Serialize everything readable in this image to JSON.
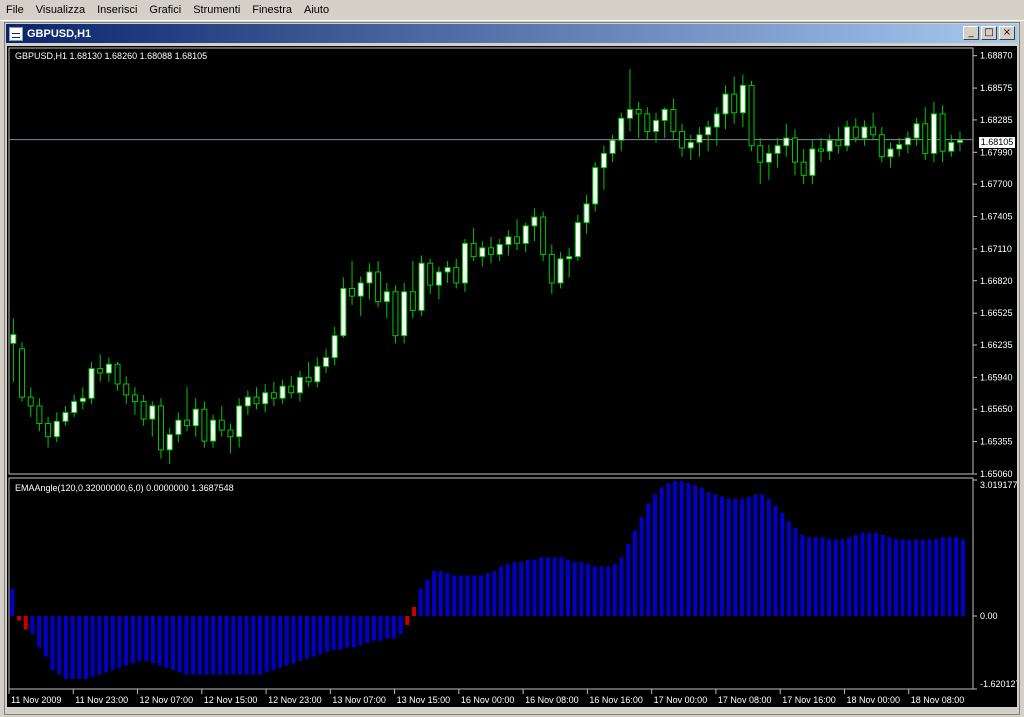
{
  "menu": [
    "File",
    "Visualizza",
    "Inserisci",
    "Grafici",
    "Strumenti",
    "Finestra",
    "Aiuto"
  ],
  "window": {
    "title": "GBPUSD,H1",
    "buttons": {
      "minimize": "_",
      "maximize": "□",
      "close": "×"
    }
  },
  "chart": {
    "symbol_label": "GBPUSD,H1  1.68130 1.68260 1.68088 1.68105",
    "current_price": "1.68105",
    "price_ticks": [
      "1.68870",
      "1.68575",
      "1.68285",
      "1.67990",
      "1.67700",
      "1.67405",
      "1.67110",
      "1.66820",
      "1.66525",
      "1.66235",
      "1.65940",
      "1.65650",
      "1.65355",
      "1.65060"
    ],
    "indicator_label": "EMAAngle(120,0.32000000,6,0) 0.0000000 1.3687548",
    "indicator_ticks": [
      "3.019177",
      "0.00",
      "-1.620127"
    ],
    "time_labels": [
      "11 Nov 2009",
      "11 Nov 23:00",
      "12 Nov 07:00",
      "12 Nov 15:00",
      "12 Nov 23:00",
      "13 Nov 07:00",
      "13 Nov 15:00",
      "16 Nov 00:00",
      "16 Nov 08:00",
      "16 Nov 16:00",
      "17 Nov 00:00",
      "17 Nov 08:00",
      "17 Nov 16:00",
      "18 Nov 00:00",
      "18 Nov 08:00"
    ],
    "colors": {
      "background": "#000000",
      "candle_bull": "#ffffff",
      "candle_bear": "#000000",
      "wick": "#00c800",
      "hist_pos": "#0000c8",
      "hist_neg": "#0000c8",
      "hist_flat": "#c80000",
      "grid_text": "#ffffff"
    }
  },
  "chart_data": {
    "type": "candlestick",
    "price_range": [
      1.6506,
      1.6894
    ],
    "candles": [
      [
        1.6625,
        1.6648,
        1.659,
        1.6633
      ],
      [
        1.662,
        1.6626,
        1.6572,
        1.6576
      ],
      [
        1.6576,
        1.6585,
        1.6558,
        1.6568
      ],
      [
        1.6568,
        1.6575,
        1.6545,
        1.6552
      ],
      [
        1.6552,
        1.6558,
        1.653,
        1.654
      ],
      [
        1.654,
        1.6562,
        1.6535,
        1.6554
      ],
      [
        1.6554,
        1.6568,
        1.655,
        1.6562
      ],
      [
        1.6562,
        1.6578,
        1.6558,
        1.6572
      ],
      [
        1.6572,
        1.6585,
        1.6565,
        1.6575
      ],
      [
        1.6575,
        1.6608,
        1.657,
        1.6602
      ],
      [
        1.6602,
        1.6615,
        1.659,
        1.6598
      ],
      [
        1.6598,
        1.6612,
        1.659,
        1.6606
      ],
      [
        1.6606,
        1.6608,
        1.6582,
        1.6588
      ],
      [
        1.6588,
        1.6595,
        1.657,
        1.6578
      ],
      [
        1.6578,
        1.6585,
        1.656,
        1.6572
      ],
      [
        1.6572,
        1.6578,
        1.655,
        1.6556
      ],
      [
        1.6556,
        1.6572,
        1.654,
        1.6568
      ],
      [
        1.6568,
        1.6575,
        1.652,
        1.6528
      ],
      [
        1.6528,
        1.6548,
        1.6515,
        1.6542
      ],
      [
        1.6542,
        1.6562,
        1.6535,
        1.6555
      ],
      [
        1.6555,
        1.6585,
        1.6545,
        1.655
      ],
      [
        1.655,
        1.6575,
        1.654,
        1.6565
      ],
      [
        1.6565,
        1.6572,
        1.653,
        1.6536
      ],
      [
        1.6536,
        1.656,
        1.653,
        1.6555
      ],
      [
        1.6555,
        1.6568,
        1.654,
        1.6546
      ],
      [
        1.6546,
        1.6552,
        1.6525,
        1.654
      ],
      [
        1.654,
        1.6575,
        1.653,
        1.6568
      ],
      [
        1.6568,
        1.6582,
        1.656,
        1.6576
      ],
      [
        1.6576,
        1.6585,
        1.6565,
        1.657
      ],
      [
        1.657,
        1.6588,
        1.6562,
        1.658
      ],
      [
        1.658,
        1.659,
        1.6568,
        1.6575
      ],
      [
        1.6575,
        1.6592,
        1.657,
        1.6586
      ],
      [
        1.6586,
        1.6595,
        1.6575,
        1.658
      ],
      [
        1.658,
        1.66,
        1.6572,
        1.6594
      ],
      [
        1.6594,
        1.6608,
        1.6585,
        1.659
      ],
      [
        1.659,
        1.6612,
        1.6585,
        1.6604
      ],
      [
        1.6604,
        1.662,
        1.6598,
        1.6612
      ],
      [
        1.6612,
        1.664,
        1.6605,
        1.6632
      ],
      [
        1.6632,
        1.6685,
        1.663,
        1.6675
      ],
      [
        1.6675,
        1.67,
        1.666,
        1.6668
      ],
      [
        1.6668,
        1.6686,
        1.665,
        1.668
      ],
      [
        1.668,
        1.6698,
        1.6665,
        1.669
      ],
      [
        1.669,
        1.67,
        1.6658,
        1.6663
      ],
      [
        1.6663,
        1.668,
        1.6648,
        1.6672
      ],
      [
        1.6672,
        1.6678,
        1.6625,
        1.6632
      ],
      [
        1.6632,
        1.668,
        1.6625,
        1.6672
      ],
      [
        1.6672,
        1.67,
        1.6648,
        1.6655
      ],
      [
        1.6655,
        1.6705,
        1.665,
        1.6698
      ],
      [
        1.6698,
        1.6702,
        1.667,
        1.6678
      ],
      [
        1.6678,
        1.6695,
        1.6665,
        1.669
      ],
      [
        1.669,
        1.67,
        1.668,
        1.6694
      ],
      [
        1.6694,
        1.6702,
        1.6675,
        1.668
      ],
      [
        1.668,
        1.672,
        1.6672,
        1.6716
      ],
      [
        1.6716,
        1.673,
        1.67,
        1.6704
      ],
      [
        1.6704,
        1.6718,
        1.6695,
        1.6712
      ],
      [
        1.6712,
        1.6722,
        1.6698,
        1.6706
      ],
      [
        1.6706,
        1.672,
        1.67,
        1.6715
      ],
      [
        1.6715,
        1.6728,
        1.6705,
        1.6722
      ],
      [
        1.6722,
        1.6738,
        1.671,
        1.6716
      ],
      [
        1.6716,
        1.6735,
        1.6708,
        1.6732
      ],
      [
        1.6732,
        1.6748,
        1.6718,
        1.674
      ],
      [
        1.674,
        1.6745,
        1.67,
        1.6706
      ],
      [
        1.6706,
        1.6715,
        1.667,
        1.668
      ],
      [
        1.668,
        1.6708,
        1.6675,
        1.6702
      ],
      [
        1.6702,
        1.6712,
        1.6685,
        1.6704
      ],
      [
        1.6704,
        1.6742,
        1.67,
        1.6735
      ],
      [
        1.6735,
        1.676,
        1.6725,
        1.6752
      ],
      [
        1.6752,
        1.679,
        1.6745,
        1.6785
      ],
      [
        1.6785,
        1.6805,
        1.6765,
        1.6798
      ],
      [
        1.6798,
        1.6815,
        1.679,
        1.681
      ],
      [
        1.681,
        1.6835,
        1.68,
        1.683
      ],
      [
        1.683,
        1.6875,
        1.6818,
        1.6838
      ],
      [
        1.6838,
        1.6845,
        1.6812,
        1.6834
      ],
      [
        1.6834,
        1.684,
        1.681,
        1.6818
      ],
      [
        1.6818,
        1.6835,
        1.6808,
        1.6828
      ],
      [
        1.6828,
        1.684,
        1.6812,
        1.6838
      ],
      [
        1.6838,
        1.6848,
        1.681,
        1.6818
      ],
      [
        1.6818,
        1.6825,
        1.6795,
        1.6803
      ],
      [
        1.6803,
        1.6815,
        1.6792,
        1.6808
      ],
      [
        1.6808,
        1.6822,
        1.6795,
        1.6815
      ],
      [
        1.6815,
        1.6828,
        1.68,
        1.6822
      ],
      [
        1.6822,
        1.684,
        1.6805,
        1.6834
      ],
      [
        1.6834,
        1.686,
        1.682,
        1.6852
      ],
      [
        1.6852,
        1.6868,
        1.6825,
        1.6835
      ],
      [
        1.6835,
        1.687,
        1.6822,
        1.686
      ],
      [
        1.686,
        1.6864,
        1.68,
        1.6805
      ],
      [
        1.6805,
        1.6812,
        1.677,
        1.679
      ],
      [
        1.679,
        1.6806,
        1.6774,
        1.6798
      ],
      [
        1.6798,
        1.6812,
        1.6785,
        1.6805
      ],
      [
        1.6805,
        1.6825,
        1.6795,
        1.6812
      ],
      [
        1.6812,
        1.682,
        1.6778,
        1.679
      ],
      [
        1.679,
        1.6802,
        1.677,
        1.6778
      ],
      [
        1.6778,
        1.681,
        1.677,
        1.6802
      ],
      [
        1.6802,
        1.6812,
        1.679,
        1.68
      ],
      [
        1.68,
        1.6815,
        1.6792,
        1.681
      ],
      [
        1.681,
        1.6822,
        1.6798,
        1.6805
      ],
      [
        1.6805,
        1.6828,
        1.68,
        1.6822
      ],
      [
        1.6822,
        1.683,
        1.6808,
        1.6812
      ],
      [
        1.6812,
        1.6828,
        1.6805,
        1.6822
      ],
      [
        1.6822,
        1.6835,
        1.681,
        1.6815
      ],
      [
        1.6815,
        1.6822,
        1.679,
        1.6795
      ],
      [
        1.6795,
        1.6808,
        1.6785,
        1.6802
      ],
      [
        1.6802,
        1.6812,
        1.6795,
        1.6806
      ],
      [
        1.6806,
        1.6818,
        1.6798,
        1.6812
      ],
      [
        1.6812,
        1.683,
        1.6805,
        1.6825
      ],
      [
        1.6825,
        1.684,
        1.6792,
        1.6798
      ],
      [
        1.6798,
        1.6845,
        1.679,
        1.6834
      ],
      [
        1.6834,
        1.6842,
        1.679,
        1.68
      ],
      [
        1.68,
        1.6815,
        1.6795,
        1.6808
      ],
      [
        1.6808,
        1.6818,
        1.68,
        1.681
      ]
    ],
    "indicator_range": [
      -1.620127,
      3.019177
    ],
    "indicator": [
      0.6,
      -0.1,
      -0.3,
      -0.4,
      -0.7,
      -0.9,
      -1.2,
      -1.3,
      -1.4,
      -1.4,
      -1.4,
      -1.4,
      -1.35,
      -1.3,
      -1.25,
      -1.2,
      -1.15,
      -1.1,
      -1.05,
      -1.0,
      -1.0,
      -1.05,
      -1.1,
      -1.15,
      -1.2,
      -1.25,
      -1.3,
      -1.3,
      -1.3,
      -1.3,
      -1.3,
      -1.3,
      -1.3,
      -1.3,
      -1.3,
      -1.3,
      -1.3,
      -1.3,
      -1.25,
      -1.2,
      -1.15,
      -1.1,
      -1.05,
      -1.0,
      -0.95,
      -0.9,
      -0.85,
      -0.8,
      -0.75,
      -0.75,
      -0.7,
      -0.7,
      -0.65,
      -0.6,
      -0.55,
      -0.55,
      -0.5,
      -0.5,
      -0.4,
      -0.2,
      0.2,
      0.6,
      0.8,
      1.0,
      1.0,
      0.95,
      0.9,
      0.9,
      0.9,
      0.9,
      0.9,
      0.95,
      1.0,
      1.1,
      1.15,
      1.2,
      1.2,
      1.25,
      1.25,
      1.3,
      1.3,
      1.3,
      1.3,
      1.25,
      1.2,
      1.2,
      1.15,
      1.1,
      1.1,
      1.1,
      1.15,
      1.3,
      1.6,
      1.9,
      2.2,
      2.5,
      2.7,
      2.85,
      2.95,
      3.0,
      3.0,
      2.95,
      2.9,
      2.85,
      2.75,
      2.7,
      2.65,
      2.6,
      2.6,
      2.6,
      2.65,
      2.7,
      2.7,
      2.6,
      2.45,
      2.3,
      2.1,
      1.95,
      1.8,
      1.75,
      1.75,
      1.75,
      1.7,
      1.7,
      1.7,
      1.75,
      1.8,
      1.85,
      1.85,
      1.85,
      1.8,
      1.75,
      1.7,
      1.7,
      1.7,
      1.7,
      1.7,
      1.7,
      1.7,
      1.75,
      1.75,
      1.75,
      1.7
    ]
  }
}
